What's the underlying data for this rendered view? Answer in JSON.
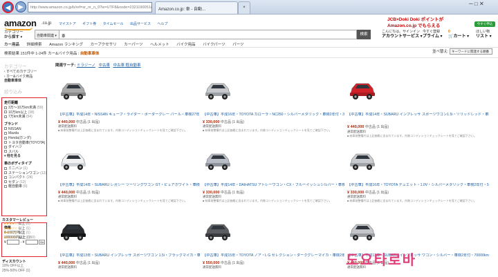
{
  "browser": {
    "url": "http://www.amazon.co.jp/b/ref=sr_nr_n_0?ie=UTF8&node=2321190051&rh=n%3A2045155051",
    "tab_active": "Amazon.co.jp: 車 - 自動...",
    "tab_new": "×",
    "window_controls": "─ □ ✕"
  },
  "header": {
    "logo": "amazon",
    "logo_suffix": ".co.jp",
    "top_links": [
      "マイストア",
      "ギフト券",
      "タイムセール",
      "出品サービス",
      "ヘルプ"
    ],
    "promo_line1": "JCB×Doki Doki ポイントが",
    "promo_line2": "Amazon.co.jp でもらえる",
    "promo_button": "今すぐ申込",
    "category_label_1": "カテゴリー",
    "category_label_2": "から探す ▾",
    "search_category": "自動車関連 ▾",
    "search_value": "車",
    "search_button": "検索",
    "account_line1": "こんにちは。サインイン",
    "account_line2": "アカウントサービス ▾",
    "prime_line1": "今すぐ登録",
    "prime_line2": "プライム ▾",
    "cart_count": "0",
    "cart_label": "カート ▾",
    "wishlist_line1": "ほしい物",
    "wishlist_line2": "リスト ▾"
  },
  "subnav": [
    "カー用品",
    "詳細検索",
    "Amazon ランキング",
    "カーアクセサリ",
    "カーパーツ",
    "ヘルメット",
    "バイク用品",
    "バイクパーツ",
    "パーツ"
  ],
  "results": {
    "summary": "検索結果 151件中 1-24件 カー&バイク用品 : ",
    "summary_term": "自動車車体",
    "sort_label": "並べ替え:",
    "sort_value": "キーワードに関連する順番"
  },
  "breadcrumb": {
    "label": "関連サーチ:",
    "links": [
      "ミラジーノ",
      "中古車",
      "中古車 軽自動車"
    ]
  },
  "sidebar": {
    "category_title": "カテゴリー",
    "links": [
      "‹ すべてのカテゴリー",
      "‹ カー&バイク用品",
      "自動車車体"
    ],
    "refine_title": "絞り込み",
    "mileage_title": "走行距離",
    "mileage": [
      {
        "label": "3万〜10万km未満",
        "count": "(59)"
      },
      {
        "label": "10万km以上",
        "count": "(38)"
      },
      {
        "label": "7万km未満",
        "count": "(54)"
      }
    ],
    "brand_title": "ブランド",
    "brands": [
      {
        "label": "NISSAN",
        "count": ""
      },
      {
        "label": "Mazda",
        "count": ""
      },
      {
        "label": "Honda(ホンダ)",
        "count": ""
      },
      {
        "label": "トヨタ自動車(TOYOTA)",
        "count": ""
      },
      {
        "label": "ダイハツ",
        "count": ""
      },
      {
        "label": "スバル",
        "count": ""
      }
    ],
    "brand_more": "▾ 他を見る",
    "body_title": "車のボディタイプ",
    "body_types": [
      {
        "label": "ミニバン",
        "count": "(1)"
      },
      {
        "label": "ステーションワゴン",
        "count": "(12)"
      },
      {
        "label": "コンパクト",
        "count": "(24)"
      },
      {
        "label": "セダン",
        "count": "(12)"
      },
      {
        "label": "軽自動車",
        "count": "(6)"
      }
    ],
    "review_title": "カスタマーレビュー",
    "reviews": [
      {
        "stars": "★★★★☆",
        "label": "以上",
        "count": "(1)"
      },
      {
        "stars": "★★★☆☆",
        "label": "以上",
        "count": "(1)"
      },
      {
        "stars": "★★☆☆☆",
        "label": "以上",
        "count": "(1)"
      },
      {
        "stars": "★☆☆☆☆",
        "label": "以上",
        "count": "(1)"
      }
    ],
    "price_title": "価格",
    "prices": [
      {
        "label": "0-100万円",
        "count": "(1)"
      },
      {
        "label": "100000円以上",
        "count": "(150)"
      }
    ],
    "price_yen": "¥",
    "price_sep": "- ¥",
    "price_go": "Go",
    "discount_title": "ディスカウント",
    "discounts": [
      "10% OFF以上",
      "25%-50% OFF (1)",
      "50%-70% OFF"
    ]
  },
  "products": [
    {
      "title": "【中古車】平成14年・NISSAN キューブ・ライダー・ボーダーグレー パール・車検27年11月・47600km",
      "price": "¥ 440,000",
      "cond": "中古品",
      "stock": "(1 出品)",
      "ship": "通常配送無料",
      "note": "■ 納車前整備代は上記価格に含まれています。内装コンディションチェックシートを見てご確認下さい。",
      "body": "#a9a9a9",
      "cab": "#8a8a8a"
    },
    {
      "title": "【中古車】平成16年・TOYOTA カローラ・NC250・シルバーメタリック・車検2年付・39500km",
      "price": "¥ 330,000",
      "cond": "中古品",
      "stock": "(1 出品)",
      "ship": "通常配送無料",
      "note": "■ 納車前整備代は上記価格に含まれています。内装コンディションチェックシートを見てご確認下さい。",
      "body": "#c7c9cc",
      "cab": "#9aa0a6"
    },
    {
      "title": "【中古車】平成14年・SUBARU インプレッサ スポーツワゴン1.5i・ソリッドレッド・車検2年付・44800km",
      "price": "¥ 440,000",
      "cond": "中古品",
      "stock": "(1 出品)",
      "ship": "通常配送無料",
      "note": "■ 納車前整備代は上記価格に含まれています。内装コンディションチェックシートを見てご確認下さい。",
      "body": "#d2232a",
      "cab": "#a81c22"
    },
    {
      "title": "【中古車】平成14年・SUBARU レガシー ツーリングワゴン GT・ピュアホワイト・車検2年付・64000km",
      "price": "¥ 440,000",
      "cond": "中古品",
      "stock": "(1 出品)",
      "ship": "通常配送無料",
      "note": "■ 納車前整備代は上記価格に含まれています。内装コンディションチェックシートを見てご確認下さい。",
      "body": "#f2f2f2",
      "cab": "#cfd3d8"
    },
    {
      "title": "【中古車】平成14年・DAIHATSU アトレーワゴン・CX・ブルーイッシュシルバー・車検2年付・103000km",
      "price": "¥ 330,000",
      "cond": "中古品",
      "stock": "(1 出品)",
      "ship": "通常配送無料",
      "note": "■ 納車前整備代は上記価格に含まれています。内装コンディションチェックシートを見てご確認下さい。",
      "body": "#b9bec6",
      "cab": "#8c939c"
    },
    {
      "title": "【中古車】平成16年・TOYOTA デュエット・1.0V・シルバーメタリック・車検2年付・50000km",
      "price": "¥ 330,000",
      "cond": "中古品",
      "stock": "(1 出品)",
      "ship": "通常配送無料",
      "note": "■ 納車前整備代は上記価格に含まれています。内装コンディションチェックシートを見てご確認下さい。",
      "body": "#c9cbce",
      "cab": "#a0a4a8"
    },
    {
      "title": "【中古車】平成13年・SUBARU インプレッサ スポーツワゴン 1.5i・ブラックマイカ・車検2年付・57900km",
      "price": "¥ 440,000",
      "cond": "中古品",
      "stock": "(1 出品)",
      "ship": "通常配送無料",
      "note": "",
      "body": "#2a2b2e",
      "cab": "#141517"
    },
    {
      "title": "【中古車】平成15年・TOYOTA ノア・L G セレクション・ダークグレーマイカ・車検2年付・85600km",
      "price": "¥ 550,000",
      "cond": "中古品",
      "stock": "(1 出品)",
      "ship": "通常配送無料",
      "note": "",
      "body": "#5b5d61",
      "cab": "#3a3c40"
    },
    {
      "title": "【中古車】平成13年・SUBARU インプレッサ ワゴン・シルバー・車検2年付・70000km",
      "price": "¥ 440,000",
      "cond": "中古品",
      "stock": "(1 出品)",
      "ship": "通常配送無料",
      "note": "",
      "body": "#c4c6c9",
      "cab": "#9a9ea2"
    }
  ],
  "overlay_text": "도요타로바",
  "colors": {
    "link": "#1b5ea8",
    "price": "#b12704",
    "highlight_box": "#e0202a",
    "accent": "#f0a020"
  }
}
